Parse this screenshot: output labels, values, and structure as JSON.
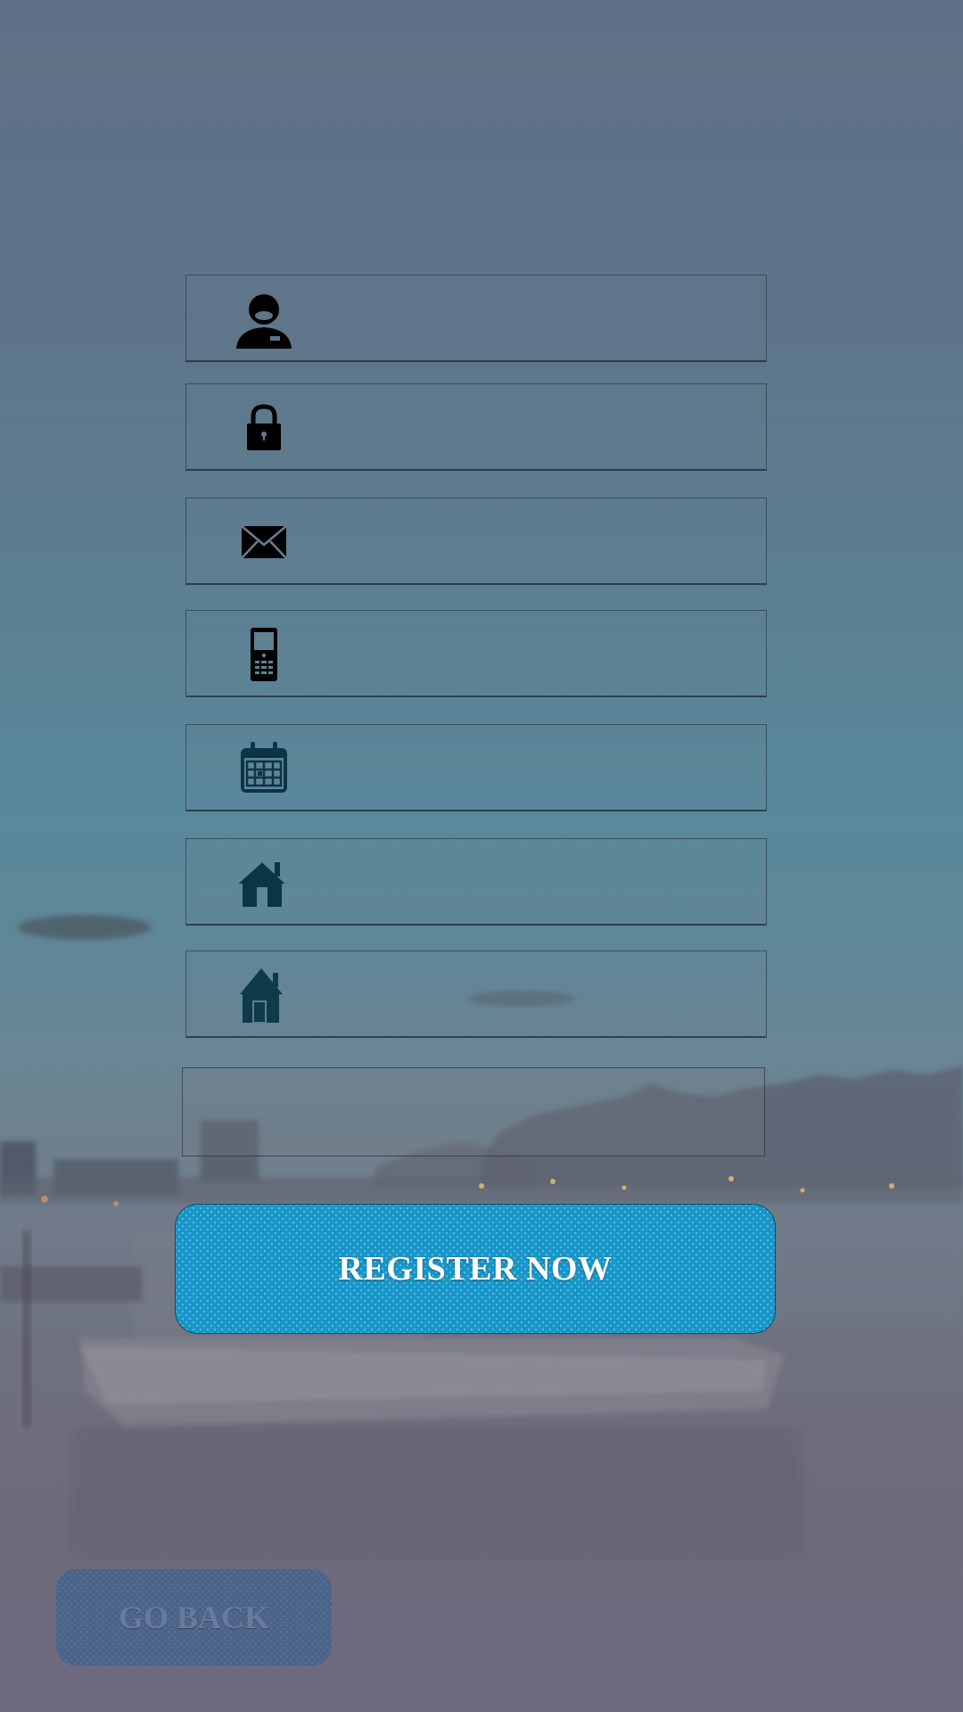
{
  "form": {
    "fields": [
      {
        "name": "username",
        "icon": "user-icon",
        "value": ""
      },
      {
        "name": "password",
        "icon": "lock-icon",
        "value": ""
      },
      {
        "name": "email",
        "icon": "envelope-icon",
        "value": ""
      },
      {
        "name": "phone",
        "icon": "mobile-phone-icon",
        "value": ""
      },
      {
        "name": "date",
        "icon": "calendar-icon",
        "value": ""
      },
      {
        "name": "address",
        "icon": "house-icon",
        "value": ""
      },
      {
        "name": "address-2",
        "icon": "home-icon",
        "value": ""
      },
      {
        "name": "extra",
        "icon": "",
        "value": ""
      }
    ],
    "register_label": "REGISTER NOW",
    "back_label": "GO BACK"
  },
  "colors": {
    "register_button": "#1796c9",
    "back_button": "#45628a",
    "icon_dark": "#000000",
    "icon_teal": "#0b3446"
  }
}
